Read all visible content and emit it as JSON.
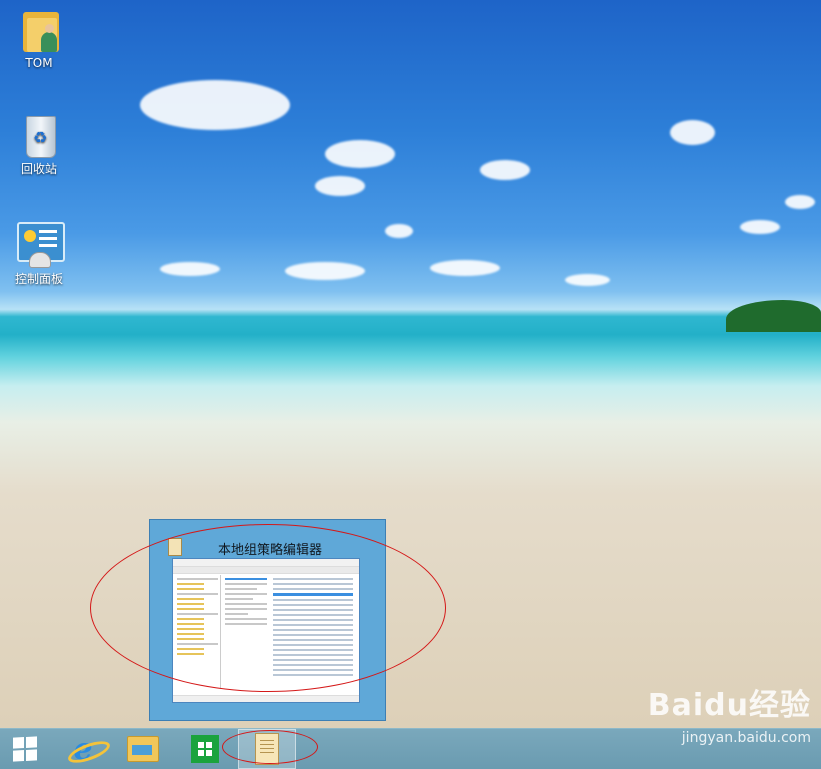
{
  "desktop": {
    "icons": [
      {
        "label": "TOM",
        "icon": "user-folder-icon"
      },
      {
        "label": "回收站",
        "icon": "recycle-bin-icon"
      },
      {
        "label": "控制面板",
        "icon": "control-panel-icon"
      }
    ]
  },
  "taskbar": {
    "items": [
      {
        "icon": "windows-start-icon"
      },
      {
        "icon": "internet-explorer-icon"
      },
      {
        "icon": "file-explorer-icon"
      },
      {
        "icon": "windows-store-icon"
      },
      {
        "icon": "group-policy-editor-icon",
        "active": true
      }
    ]
  },
  "preview": {
    "title": "本地组策略编辑器",
    "icon": "group-policy-editor-icon"
  },
  "annotations": {
    "color": "#d41818"
  },
  "watermark": {
    "logo": "Baidu经验",
    "url": "jingyan.baidu.com"
  }
}
